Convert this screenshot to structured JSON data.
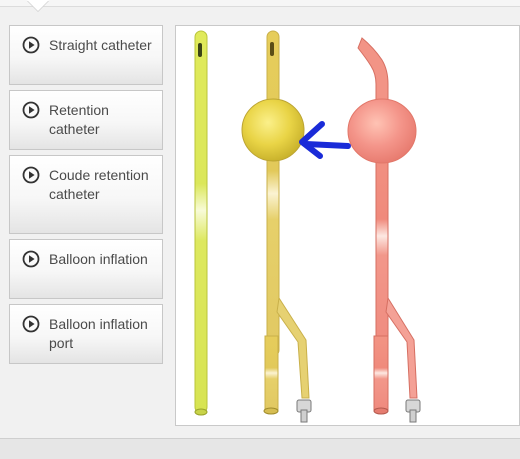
{
  "menu": {
    "items": [
      {
        "label": "Straight catheter",
        "icon": "play-circle-icon"
      },
      {
        "label": "Retention catheter",
        "icon": "play-circle-icon"
      },
      {
        "label": "Coude retention catheter",
        "icon": "play-circle-icon"
      },
      {
        "label": "Balloon inflation",
        "icon": "play-circle-icon"
      },
      {
        "label": "Balloon inflation port",
        "icon": "play-circle-icon"
      }
    ]
  },
  "colors": {
    "straight": "#d9e64a",
    "retention": "#e5cd55",
    "coude": "#f08a7d",
    "arrow": "#1a2bd8",
    "button_text": "#4a4a4a"
  }
}
